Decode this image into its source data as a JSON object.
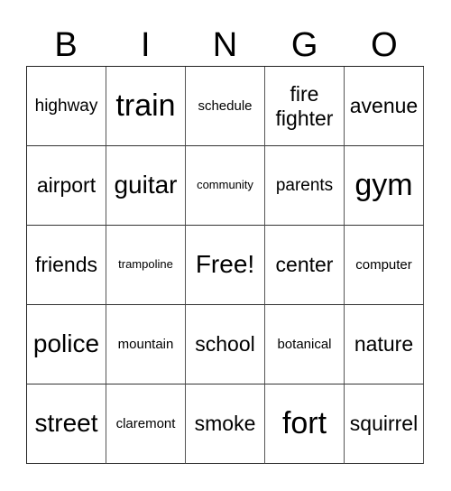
{
  "header": [
    "B",
    "I",
    "N",
    "G",
    "O"
  ],
  "cells": [
    [
      {
        "text": "highway",
        "size": "md"
      },
      {
        "text": "train",
        "size": "xxl"
      },
      {
        "text": "schedule",
        "size": "sm"
      },
      {
        "text": "fire fighter",
        "size": "lg"
      },
      {
        "text": "avenue",
        "size": "lg"
      }
    ],
    [
      {
        "text": "airport",
        "size": "lg"
      },
      {
        "text": "guitar",
        "size": "xl"
      },
      {
        "text": "community",
        "size": "xs"
      },
      {
        "text": "parents",
        "size": "md"
      },
      {
        "text": "gym",
        "size": "xxl"
      }
    ],
    [
      {
        "text": "friends",
        "size": "lg"
      },
      {
        "text": "trampoline",
        "size": "xs"
      },
      {
        "text": "Free!",
        "size": "xl"
      },
      {
        "text": "center",
        "size": "lg"
      },
      {
        "text": "computer",
        "size": "sm"
      }
    ],
    [
      {
        "text": "police",
        "size": "xl"
      },
      {
        "text": "mountain",
        "size": "sm"
      },
      {
        "text": "school",
        "size": "lg"
      },
      {
        "text": "botanical",
        "size": "sm"
      },
      {
        "text": "nature",
        "size": "lg"
      }
    ],
    [
      {
        "text": "street",
        "size": "xl"
      },
      {
        "text": "claremont",
        "size": "sm"
      },
      {
        "text": "smoke",
        "size": "lg"
      },
      {
        "text": "fort",
        "size": "xxl"
      },
      {
        "text": "squirrel",
        "size": "lg"
      }
    ]
  ]
}
